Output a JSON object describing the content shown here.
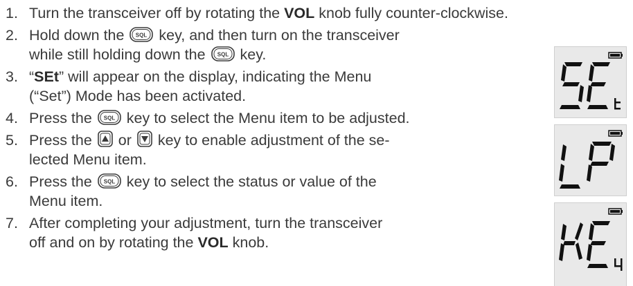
{
  "steps": [
    {
      "num": "1.",
      "a": "Turn the transceiver off by rotating the ",
      "b": "VOL",
      "c": " knob fully counter-clockwise."
    },
    {
      "num": "2.",
      "a": "Hold down the ",
      "b": " key, and then turn on the transceiver",
      "c": "while still holding down the ",
      "d": " key."
    },
    {
      "num": "3.",
      "a": "“",
      "b": "SEt",
      "c": "” will appear on the display, indicating the Menu",
      "d": "(“Set”) Mode has been activated."
    },
    {
      "num": "4.",
      "a": "Press the ",
      "b": " key to select the Menu item to be adjusted."
    },
    {
      "num": "5.",
      "a": "Press the ",
      "b": " or ",
      "c": " key to enable adjustment of the se-",
      "d": "lected Menu item."
    },
    {
      "num": "6.",
      "a": "Press the ",
      "b": " key to select the status or value of the",
      "c": "Menu item."
    },
    {
      "num": "7.",
      "a": "After completing your adjustment, turn the transceiver",
      "b": "off and on by rotating the ",
      "c": "VOL",
      "d": " knob."
    }
  ],
  "keys": {
    "sql": "SQL"
  },
  "icons": {
    "sql": "sql-key-icon",
    "up": "up-key-icon",
    "down": "down-key-icon",
    "battery": "battery-icon"
  },
  "lcd": {
    "display1": {
      "big": "SE",
      "small": "t"
    },
    "display2": {
      "big": "LP",
      "small": ""
    },
    "display3": {
      "big": "KE",
      "small": "y"
    }
  }
}
